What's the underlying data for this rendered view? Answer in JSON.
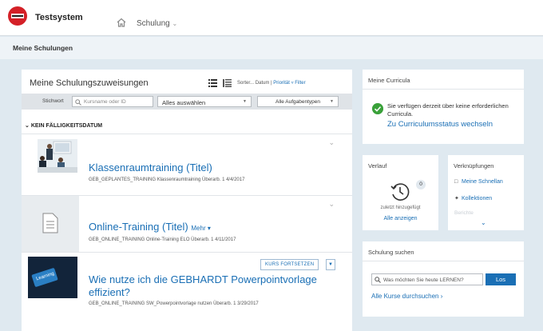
{
  "header": {
    "app_title": "Testsystem",
    "nav_label": "Schulung"
  },
  "breadcrumb": {
    "label": "Meine Schulungen"
  },
  "assignments": {
    "title": "Meine Schulungszuweisungen",
    "sort": {
      "label": "Sorter...",
      "by_date": "Datum",
      "separator": "|",
      "by_priority": "Priorität",
      "filter": "Filter"
    },
    "filterbar": {
      "keyword_label": "Stichwort",
      "search_placeholder": "Kursname oder ID",
      "select_all": "Alles auswählen",
      "task_types": "Alle Aufgabentypen"
    },
    "group_header": "KEIN FÄLLIGKEITSDATUM",
    "items": [
      {
        "title": "Klassenraumtraining (Titel)",
        "meta": "GEB_GEPLANTES_TRAINING Klassenraumtraining Überarb. 1 4/4/2017",
        "thumb_icon": "classroom-photo"
      },
      {
        "title": "Online-Training (Titel)",
        "more": "Mehr ▾",
        "meta": "GEB_ONLINE_TRAINING Online-Training ELO Überarb. 1 4/11/2017",
        "thumb_icon": "document-icon"
      },
      {
        "title": "Wie nutze ich die GEBHARDT Powerpointvorlage effizient?",
        "meta": "GEB_ONLINE_TRAINING SW_Powerpointvorlage nutzen Überarb. 1 3/29/2017",
        "button": "KURS FORTSETZEN",
        "thumb_icon": "learning-key-photo",
        "thumb_text": "Learning"
      }
    ]
  },
  "curricula": {
    "title": "Meine Curricula",
    "message": "Sie verfügen derzeit über keine erforderlichen Curricula.",
    "link": "Zu Curriculumsstatus wechseln"
  },
  "verlauf": {
    "title": "Verlauf",
    "count": "0",
    "subtitle": "zuletzt hinzugefügt",
    "link": "Alle anzeigen"
  },
  "verknuepfungen": {
    "title": "Verknüpfungen",
    "items": [
      {
        "label": "Meine Schnellan",
        "icon": "doc-icon"
      },
      {
        "label": "Kollektionen",
        "icon": "puzzle-icon"
      }
    ],
    "faded": "Berichte"
  },
  "search": {
    "title": "Schulung suchen",
    "placeholder": "Was möchten Sie heute LERNEN?",
    "button": "Los",
    "link": "Alle Kurse durchsuchen"
  },
  "colors": {
    "accent": "#1a6fb5",
    "brand": "#d42027",
    "success": "#3aa13a",
    "background": "#dfe9f0"
  }
}
